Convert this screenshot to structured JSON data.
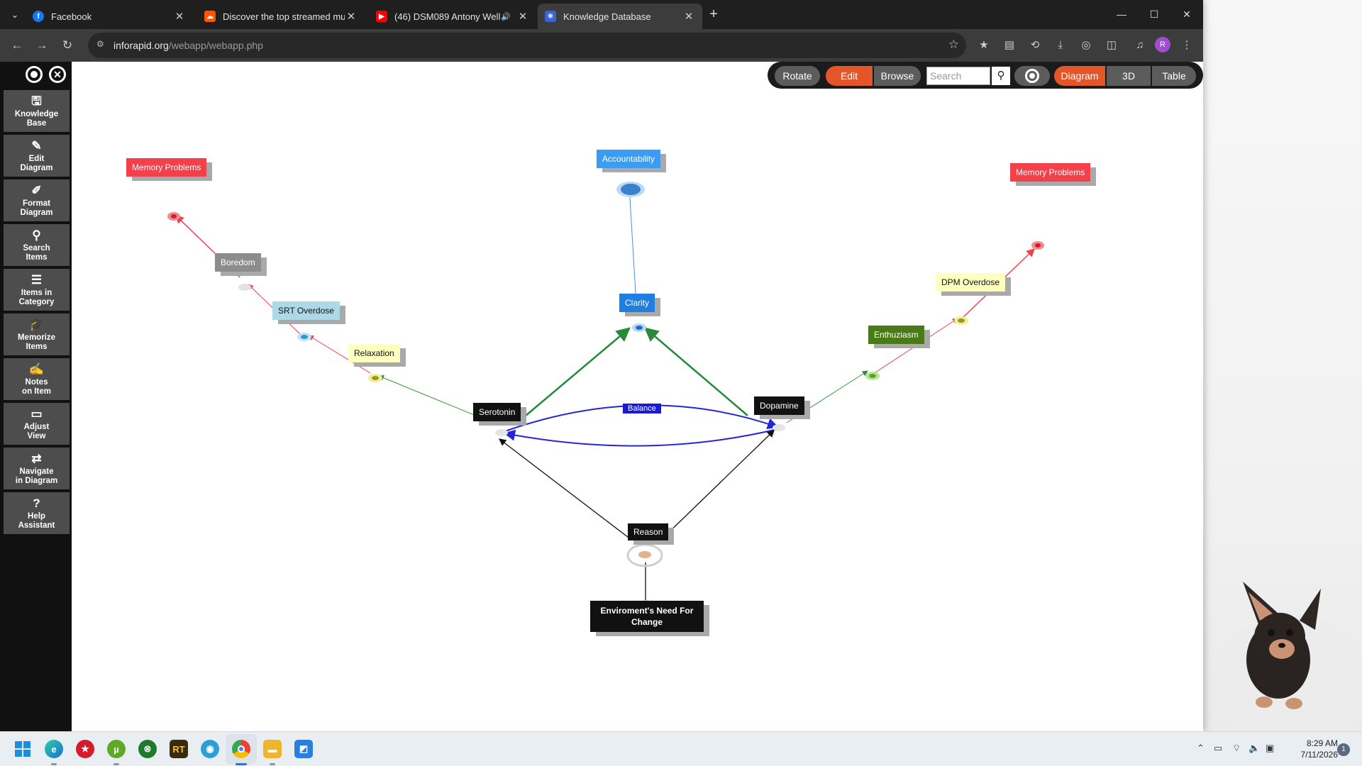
{
  "browser": {
    "tabs": [
      {
        "title": "Facebook",
        "icon": "facebook-icon"
      },
      {
        "title": "Discover the top streamed mus",
        "icon": "soundcloud-icon"
      },
      {
        "title": "(46) DSM089 Antony Well",
        "icon": "youtube-icon"
      },
      {
        "title": "Knowledge Database",
        "icon": "inforapid-icon"
      }
    ],
    "url_host": "inforapid.org",
    "url_path": "/webapp/webapp.php",
    "profile_initial": "R"
  },
  "sidebar": {
    "items": [
      {
        "line1": "Knowledge",
        "line2": "Base",
        "icon": "save-icon"
      },
      {
        "line1": "Edit",
        "line2": "Diagram",
        "icon": "pencil-icon"
      },
      {
        "line1": "Format",
        "line2": "Diagram",
        "icon": "brush-icon"
      },
      {
        "line1": "Search",
        "line2": "Items",
        "icon": "search-icon"
      },
      {
        "line1": "Items in",
        "line2": "Category",
        "icon": "list-icon"
      },
      {
        "line1": "Memorize",
        "line2": "Items",
        "icon": "graduation-cap-icon"
      },
      {
        "line1": "Notes",
        "line2": "on Item",
        "icon": "notes-icon"
      },
      {
        "line1": "Adjust",
        "line2": "View",
        "icon": "monitor-icon"
      },
      {
        "line1": "Navigate",
        "line2": "in Diagram",
        "icon": "arrows-icon"
      },
      {
        "line1": "Help",
        "line2": "Assistant",
        "icon": "help-icon"
      }
    ]
  },
  "topbar": {
    "rotate": "Rotate",
    "edit": "Edit",
    "browse": "Browse",
    "search_placeholder": "Search",
    "diagram": "Diagram",
    "three_d": "3D",
    "table": "Table"
  },
  "colors": {
    "red": "#f2414a",
    "gray": "#8c8c8c",
    "lightblue": "#add8e6",
    "lightyellow": "#ffffc0",
    "blue": "#3a9cf3",
    "clarity": "#1e7fe0",
    "green": "#4a7a17",
    "black": "#111111",
    "orange": "#e2562a"
  },
  "diagram": {
    "nodes": {
      "memory_left": "Memory Problems",
      "boredom": "Boredom",
      "srt_overdose": "SRT Overdose",
      "relaxation": "Relaxation",
      "accountability": "Accountability",
      "clarity": "Clarity",
      "serotonin": "Serotonin",
      "dopamine": "Dopamine",
      "balance": "Balance",
      "reason": "Reason",
      "environment_line1": "Enviroment's Need For",
      "environment_line2": "Change",
      "enthuziasm": "Enthuziasm",
      "dpm_overdose": "DPM Overdose",
      "memory_right": "Memory Problems"
    }
  },
  "taskbar": {
    "apps": [
      "windows-start-icon",
      "edge-icon",
      "app-red-icon",
      "utorrent-icon",
      "xbox-icon",
      "rt3-icon",
      "globe-icon",
      "chrome-icon",
      "file-explorer-icon",
      "photos-icon"
    ],
    "time": "8:29 AM",
    "date": "7/11/2026",
    "notifications": "1"
  }
}
